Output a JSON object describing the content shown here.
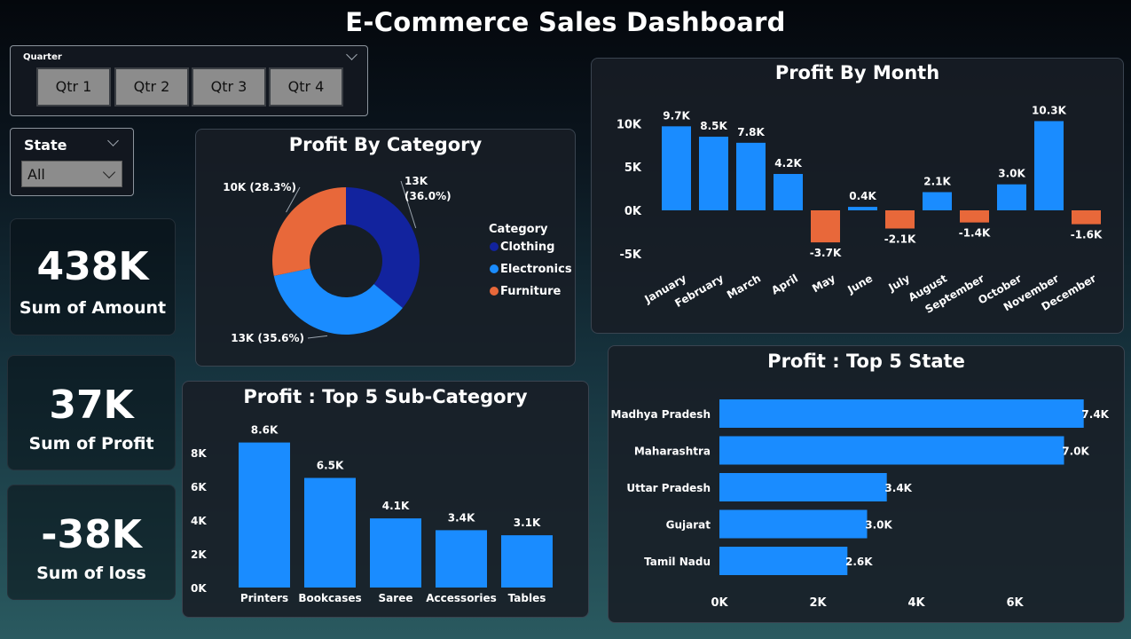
{
  "dashboard": {
    "title": "E-Commerce Sales Dashboard"
  },
  "filters": {
    "quarter": {
      "label": "Quarter",
      "options": [
        "Qtr 1",
        "Qtr 2",
        "Qtr 3",
        "Qtr 4"
      ]
    },
    "state": {
      "label": "State",
      "selected": "All"
    }
  },
  "kpis": [
    {
      "value": "438K",
      "label": "Sum of Amount"
    },
    {
      "value": "37K",
      "label": "Sum of Profit"
    },
    {
      "value": "-38K",
      "label": "Sum of loss"
    }
  ],
  "colors": {
    "blue": "#1a8cff",
    "orange": "#e8683a",
    "navy": "#12239e"
  },
  "chart_data": [
    {
      "id": "category",
      "type": "pie",
      "title": "Profit By Category",
      "legend_title": "Category",
      "legend_position": "right",
      "categories": [
        "Clothing",
        "Electronics",
        "Furniture"
      ],
      "values": [
        13000,
        12900,
        10200
      ],
      "percents": [
        36.0,
        35.6,
        28.3
      ],
      "data_labels": [
        "13K (36.0%)",
        "13K (35.6%)",
        "10K (28.3%)"
      ],
      "colors": [
        "#12239e",
        "#1a8cff",
        "#e8683a"
      ]
    },
    {
      "id": "month",
      "type": "bar",
      "title": "Profit By Month",
      "categories": [
        "January",
        "February",
        "March",
        "April",
        "May",
        "June",
        "July",
        "August",
        "September",
        "October",
        "November",
        "December"
      ],
      "values": [
        9700,
        8500,
        7800,
        4200,
        -3700,
        400,
        -2100,
        2100,
        -1400,
        3000,
        10300,
        -1600
      ],
      "data_labels": [
        "9.7K",
        "8.5K",
        "7.8K",
        "4.2K",
        "-3.7K",
        "0.4K",
        "-2.1K",
        "2.1K",
        "-1.4K",
        "3.0K",
        "10.3K",
        "-1.6K"
      ],
      "ylim": [
        -6000,
        11000
      ],
      "yticks": [
        10000,
        5000,
        0,
        -5000
      ],
      "ytick_labels": [
        "10K",
        "5K",
        "0K",
        "-5K"
      ],
      "positive_color": "#1a8cff",
      "negative_color": "#e8683a"
    },
    {
      "id": "subcat",
      "type": "bar",
      "title": "Profit : Top 5 Sub-Category",
      "categories": [
        "Printers",
        "Bookcases",
        "Saree",
        "Accessories",
        "Tables"
      ],
      "values": [
        8600,
        6500,
        4100,
        3400,
        3100
      ],
      "data_labels": [
        "8.6K",
        "6.5K",
        "4.1K",
        "3.4K",
        "3.1K"
      ],
      "ylim": [
        0,
        9000
      ],
      "yticks": [
        8000,
        6000,
        4000,
        2000,
        0
      ],
      "ytick_labels": [
        "8K",
        "6K",
        "4K",
        "2K",
        "0K"
      ],
      "color": "#1a8cff"
    },
    {
      "id": "state",
      "type": "bar",
      "orientation": "horizontal",
      "title": "Profit : Top 5 State",
      "categories": [
        "Madhya Pradesh",
        "Maharashtra",
        "Uttar Pradesh",
        "Gujarat",
        "Tamil Nadu"
      ],
      "values": [
        7400,
        7000,
        3400,
        3000,
        2600
      ],
      "data_labels": [
        "7.4K",
        "7.0K",
        "3.4K",
        "3.0K",
        "2.6K"
      ],
      "xlim": [
        0,
        7400
      ],
      "xticks": [
        0,
        2000,
        4000,
        6000
      ],
      "xtick_labels": [
        "0K",
        "2K",
        "4K",
        "6K"
      ],
      "color": "#1a8cff"
    }
  ]
}
